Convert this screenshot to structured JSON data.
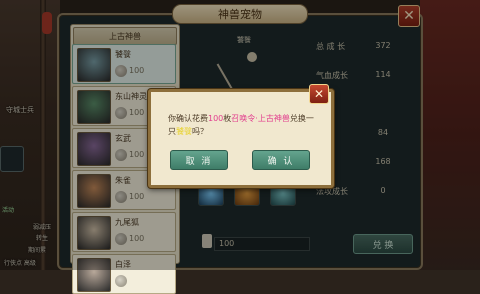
{
  "window": {
    "title": "神兽宠物"
  },
  "list": {
    "header": "上古神兽",
    "items": [
      {
        "name": "饕餮",
        "cost": "100",
        "thumb_color": "#7aa0a8",
        "selected": true
      },
      {
        "name": "东山神灵",
        "cost": "100",
        "thumb_color": "#5b8f6a"
      },
      {
        "name": "玄武",
        "cost": "100",
        "thumb_color": "#8a6a9a"
      },
      {
        "name": "朱雀",
        "cost": "100",
        "thumb_color": "#c58a5a"
      },
      {
        "name": "九尾狐",
        "cost": "100",
        "thumb_color": "#d0c0a8"
      },
      {
        "name": "白泽",
        "cost": "",
        "thumb_color": "#b8a89a"
      }
    ]
  },
  "model": {
    "name": "饕餮"
  },
  "stats": [
    {
      "label": "总 成 长",
      "value": "372"
    },
    {
      "label": "气血成长",
      "value": "114"
    },
    {
      "label": "",
      "value": ""
    },
    {
      "label": "",
      "value": "84"
    },
    {
      "label": "",
      "value": "168"
    },
    {
      "label": "法攻成长",
      "value": "0"
    }
  ],
  "footer": {
    "cost": "100",
    "exchange_label": "兑 换"
  },
  "dialog": {
    "text_prefix": "你确认花费",
    "num": "100",
    "mid": "枚",
    "item": "召唤令·上古神兽",
    "suffix": "兑换一只",
    "pet": "饕餮",
    "end": "吗？",
    "cancel": "取 消",
    "confirm": "确 认"
  },
  "background": {
    "text_a": "守城士兵",
    "text_b": "弱减压",
    "text_c": "转生",
    "text_d": "期间累",
    "text_e": "行侠点 高级",
    "mini_label": "活动"
  },
  "colors": {
    "accent": "#e23e8e",
    "highlight": "#e8d22e",
    "confirm": "#4f8f78"
  }
}
